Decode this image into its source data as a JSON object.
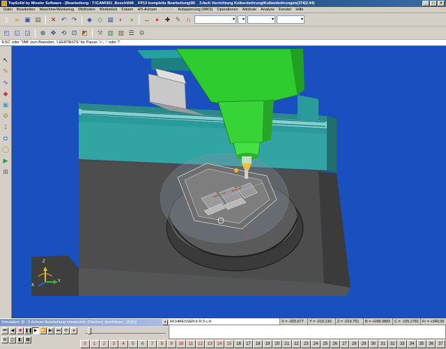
{
  "window": {
    "title": "TopSolid by Missler Software - [Bearbeitung : T:\\CAM\\301_Bosch\\046 _ FP13 komplette Bearbeitung\\90 _ 3-fach Vorrichtung Kolbenbohrung\\Kolbenbohrungen(374)2.44]",
    "minimize": "_",
    "maximize": "□",
    "close": "×"
  },
  "menu": {
    "items": [
      {
        "label": "Datei",
        "disabled": false
      },
      {
        "label": "Bearbeiten",
        "disabled": false
      },
      {
        "label": "Maschine/Werkzeug",
        "disabled": false
      },
      {
        "label": "Methoden",
        "disabled": false
      },
      {
        "label": "Werkstück",
        "disabled": false
      },
      {
        "label": "Fräsen",
        "disabled": false
      },
      {
        "label": "4/5-Achsen",
        "disabled": false
      },
      {
        "label": "Drehen",
        "disabled": true
      },
      {
        "label": "Aufspannung (WKS)",
        "disabled": false
      },
      {
        "label": "Operationen",
        "disabled": false
      },
      {
        "label": "Attribute",
        "disabled": false
      },
      {
        "label": "Analyse",
        "disabled": false
      },
      {
        "label": "Fenster",
        "disabled": false
      },
      {
        "label": "Hilfe",
        "disabled": false
      }
    ]
  },
  "toolbar1": {
    "icons": [
      {
        "name": "new-file-icon",
        "glyph": "▯",
        "color": "#ffffff"
      },
      {
        "name": "open-folder-icon",
        "glyph": "▰",
        "color": "#d8b040"
      },
      {
        "name": "save-icon",
        "glyph": "▣",
        "color": "#3050a0"
      },
      {
        "name": "print-icon",
        "glyph": "▤",
        "color": "#606060"
      },
      {
        "name": "delete-icon",
        "glyph": "✕",
        "color": "#c00000"
      },
      {
        "name": "undo-icon",
        "glyph": "↶",
        "color": "#2040a0"
      },
      {
        "name": "redo-icon",
        "glyph": "↷",
        "color": "#2040a0"
      },
      {
        "name": "render-icon",
        "glyph": "◆",
        "color": "#3060c0"
      },
      {
        "name": "wire-icon",
        "glyph": "◇",
        "color": "#208040"
      },
      {
        "name": "layer-icon",
        "glyph": "▦",
        "color": "#4070c0"
      },
      {
        "name": "hide-icon",
        "glyph": "◐",
        "color": "#a04080"
      },
      {
        "name": "shade-icon",
        "glyph": "◑",
        "color": "#40a040"
      },
      {
        "name": "measure-icon",
        "glyph": "↔",
        "color": "#404040"
      },
      {
        "name": "color-icon",
        "glyph": "●",
        "color": "#e04040"
      },
      {
        "name": "point-icon",
        "glyph": "✚",
        "color": "#202020"
      },
      {
        "name": "pen-icon",
        "glyph": "✎",
        "color": "#606060"
      },
      {
        "name": "magnet-icon",
        "glyph": "∩",
        "color": "#c02020"
      }
    ],
    "combos": [
      "",
      "",
      "",
      ""
    ]
  },
  "toolbar2": {
    "icons": [
      {
        "name": "view-iso-icon",
        "glyph": "◰",
        "color": "#2060c0"
      },
      {
        "name": "view-front-icon",
        "glyph": "◱",
        "color": "#2060c0"
      },
      {
        "name": "view-top-icon",
        "glyph": "◲",
        "color": "#2060c0"
      },
      {
        "name": "zoom-icon",
        "glyph": "⊕",
        "color": "#204080"
      },
      {
        "name": "pan-icon",
        "glyph": "✥",
        "color": "#204080"
      },
      {
        "name": "rotate-icon",
        "glyph": "⟲",
        "color": "#204080"
      },
      {
        "name": "fit-icon",
        "glyph": "⊡",
        "color": "#204080"
      },
      {
        "name": "section-icon",
        "glyph": "◩",
        "color": "#a06020"
      },
      {
        "name": "tool-icon",
        "glyph": "⚒",
        "color": "#808080"
      },
      {
        "name": "machine-icon",
        "glyph": "▥",
        "color": "#408040"
      },
      {
        "name": "stock-icon",
        "glyph": "▧",
        "color": "#806040"
      },
      {
        "name": "list-icon",
        "glyph": "☰",
        "color": "#404040"
      },
      {
        "name": "param-icon",
        "glyph": "⚙",
        "color": "#606060"
      }
    ]
  },
  "prompt": {
    "text": "'ESC' oder 'TAB' zum Beenden, 'LEERTASTE' für Pause, '+', '-' oder '/'"
  },
  "lefttools": {
    "icons": [
      {
        "name": "select-arrow-icon",
        "glyph": "↖",
        "color": "#202020"
      },
      {
        "name": "pencil-icon",
        "glyph": "✎",
        "color": "#c08020"
      },
      {
        "name": "curve-icon",
        "glyph": "∿",
        "color": "#4040c0"
      },
      {
        "name": "shape-icon",
        "glyph": "◆",
        "color": "#c04040"
      },
      {
        "name": "solid-icon",
        "glyph": "▣",
        "color": "#40a0c0"
      },
      {
        "name": "mill-icon",
        "glyph": "⚙",
        "color": "#c08020"
      },
      {
        "name": "drill-icon",
        "glyph": "↧",
        "color": "#a0a020"
      },
      {
        "name": "pocket-icon",
        "glyph": "◘",
        "color": "#2080c0"
      },
      {
        "name": "contour-icon",
        "glyph": "◯",
        "color": "#c0a020"
      },
      {
        "name": "sim-icon",
        "glyph": "▶",
        "color": "#20a040"
      },
      {
        "name": "measure-left-icon",
        "glyph": "⊞",
        "color": "#606060"
      }
    ]
  },
  "viewport": {
    "background": "#1a4fbf",
    "axes": {
      "x": "Y",
      "z": "Z",
      "y": "X"
    }
  },
  "simulation": {
    "title": "Simulation: [6 - 5 Achsen Bearbeitung umwandeln (Flächen) überfräsen...(5)(5)]",
    "close": "×",
    "controls": [
      {
        "name": "first-icon",
        "glyph": "⏮",
        "red": false,
        "active": false
      },
      {
        "name": "prev-icon",
        "glyph": "◀",
        "red": false,
        "active": false
      },
      {
        "name": "stop-icon",
        "glyph": "■",
        "red": true,
        "active": false
      },
      {
        "name": "pause-icon",
        "glyph": "❚❚",
        "red": false,
        "active": false
      },
      {
        "name": "play-icon",
        "glyph": "▶",
        "red": false,
        "active": true
      },
      {
        "name": "fast-icon",
        "glyph": "⏩",
        "red": false,
        "active": false
      },
      {
        "name": "next-icon",
        "glyph": "▶|",
        "red": false,
        "active": false
      },
      {
        "name": "last-icon",
        "glyph": "⏭",
        "red": false,
        "active": false
      },
      {
        "name": "loop-icon",
        "glyph": "⟳",
        "red": false,
        "active": false
      },
      {
        "name": "record-icon",
        "glyph": "●",
        "red": true,
        "active": false
      }
    ],
    "bottom": [
      {
        "name": "option-a-icon",
        "glyph": "⊟"
      },
      {
        "name": "option-b-icon",
        "glyph": "◫"
      },
      {
        "name": "option-c-icon",
        "glyph": "◧"
      },
      {
        "name": "option-d-icon",
        "glyph": "▦"
      }
    ]
  },
  "status": {
    "info": "RCHMESSER:6  R:3  L:4",
    "x": "X = -003.677",
    "y": "Y = -010.130",
    "z": "Z = -019.751",
    "b": "B = +098.9883",
    "c": "C = -105.2781",
    "fr": "Fr = +340.00"
  },
  "numbar": {
    "keys": [
      {
        "label": "0",
        "red": true
      },
      {
        "label": "1",
        "red": true
      },
      {
        "label": "2",
        "red": true
      },
      {
        "label": "3",
        "red": true
      },
      {
        "label": "4",
        "red": true
      },
      {
        "label": "5",
        "red": true
      },
      {
        "label": "6",
        "red": true
      },
      {
        "label": "7",
        "red": true
      },
      {
        "label": "8",
        "red": true
      },
      {
        "label": "9",
        "red": true
      },
      {
        "label": "10",
        "red": true
      },
      {
        "label": "11",
        "red": true
      },
      {
        "label": "12",
        "red": true
      },
      {
        "label": "13",
        "red": true
      },
      {
        "label": "14",
        "red": true
      },
      {
        "label": "15",
        "red": true
      },
      {
        "label": "16",
        "red": false
      },
      {
        "label": "17",
        "red": false
      },
      {
        "label": "18",
        "red": false
      },
      {
        "label": "19",
        "red": false
      },
      {
        "label": "20",
        "red": false
      },
      {
        "label": "21",
        "red": false
      },
      {
        "label": "22",
        "red": false
      },
      {
        "label": "23",
        "red": false
      },
      {
        "label": "24",
        "red": false
      },
      {
        "label": "25",
        "red": false
      },
      {
        "label": "26",
        "red": false
      },
      {
        "label": "27",
        "red": false
      },
      {
        "label": "28",
        "red": false
      },
      {
        "label": "29",
        "red": false
      },
      {
        "label": "30",
        "red": false
      },
      {
        "label": "31",
        "red": false
      },
      {
        "label": "32",
        "red": false
      },
      {
        "label": "33",
        "red": false
      },
      {
        "label": "34",
        "red": false
      },
      {
        "label": "35",
        "red": false
      },
      {
        "label": "36",
        "red": false
      },
      {
        "label": "37",
        "red": false
      }
    ]
  }
}
